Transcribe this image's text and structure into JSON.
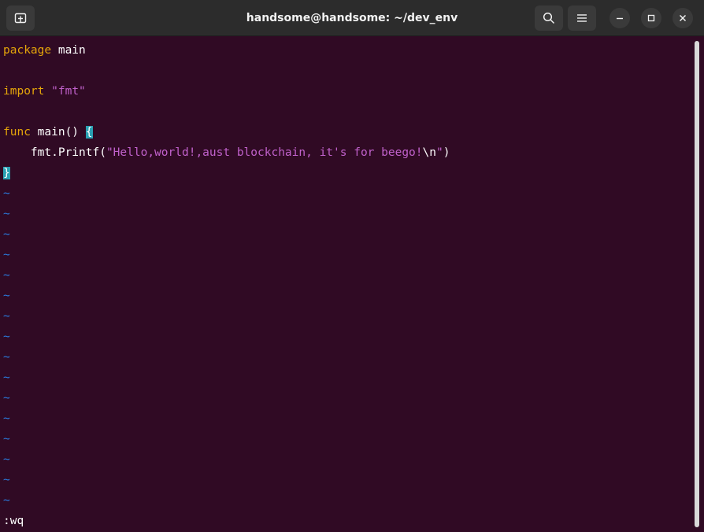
{
  "window": {
    "title": "handsome@handsome: ~/dev_env"
  },
  "toolbar": {
    "new_tab_icon": "new-tab-icon",
    "search_icon": "search-icon",
    "menu_icon": "hamburger-menu-icon",
    "minimize_icon": "minimize-icon",
    "maximize_icon": "maximize-icon",
    "close_icon": "close-icon"
  },
  "editor": {
    "line1_kw": "package",
    "line1_rest": " main",
    "line3_kw": "import",
    "line3_str": "\"fmt\"",
    "line5_kw": "func",
    "line5_rest": " main() ",
    "line5_brace": "{",
    "line6_pre": "    fmt.Printf(",
    "line6_str": "\"Hello,world!,aust blockchain, it's for beego!",
    "line6_esc": "\\n",
    "line6_strend": "\"",
    "line6_close": ")",
    "line7_brace": "}",
    "tilde": "~",
    "command": ":wq"
  },
  "colors": {
    "background": "#300a24",
    "keyword": "#e5a50a",
    "string": "#c061cb",
    "tilde": "#2a7bde",
    "matching_brace": "#2aa1b3"
  }
}
